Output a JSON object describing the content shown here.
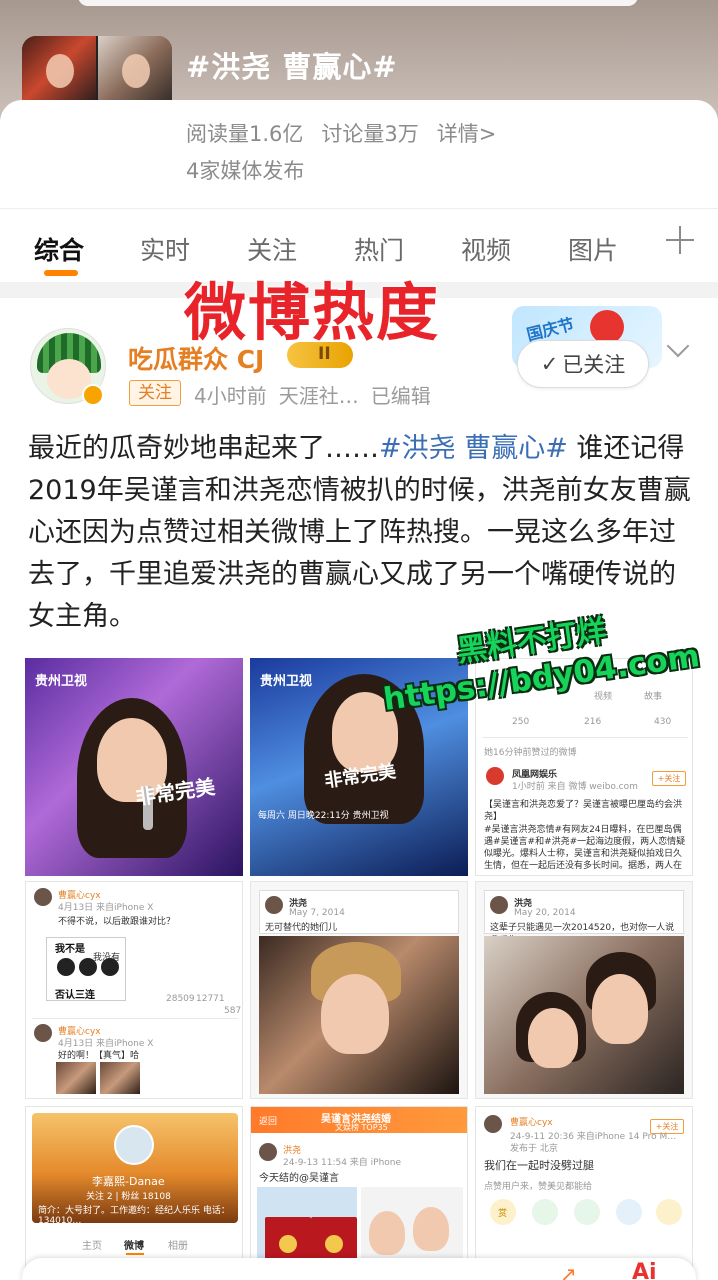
{
  "topic": {
    "title": "#洪尧 曹赢心#",
    "stats": [
      "阅读量1.6亿",
      "讨论量3万",
      "详情>"
    ],
    "media": "4家媒体发布"
  },
  "tabs": [
    "综合",
    "实时",
    "关注",
    "热门",
    "视频",
    "图片"
  ],
  "overlay_title": "微博热度",
  "post": {
    "author": "吃瓜群众 CJ",
    "level_badge": "II",
    "follow_tag": "关注",
    "meta": [
      "4小时前",
      "天涯社…",
      "已编辑"
    ],
    "followed_label": "已关注",
    "sticker_text": "国庆节",
    "text_before": "最近的瓜奇妙地串起来了……",
    "hashtag": "#洪尧 曹赢心#",
    "text_after": " 谁还记得2019年吴谨言和洪尧恋情被扒的时候，洪尧前女友曹赢心还因为点赞过相关微博上了阵热搜。一晃这么多年过去了，千里追爱洪尧的曹赢心又成了另一个嘴硬传说的女主角。"
  },
  "watermark": {
    "line1": "黑料不打烊",
    "line2": "https://bdy04.com"
  },
  "images": {
    "g1": {
      "logo": "贵州卫视",
      "show": "非常完美"
    },
    "g2": {
      "logo": "贵州卫视",
      "show": "非常完美",
      "caption": "每周六 周日晚22:11分 贵州卫视"
    },
    "g3": {
      "tabs": [
        "视频",
        "故事"
      ],
      "counts": [
        "250",
        "216",
        "430"
      ],
      "recent": "她16分钟前赞过的微博",
      "account": "凤凰网娱乐",
      "follow": "+关注",
      "source": "1小时前 来自 微博 weibo.com",
      "headline": "【吴谨言和洪尧恋爱了？吴谨言被曝巴厘岛约会洪尧】",
      "body": "#吴谨言洪尧恋情#有网友24日曝料，在巴厘岛偶遇#吴谨言#和#洪尧#一起海边度假，两人恋情疑似曝光。爆料人士称，吴谨言和洪尧疑似拍戏日久生情，但在一起后还没有多长时间。据悉，两人在《延禧攻略》《蜡笔传》中都有合作。"
    },
    "g4": {
      "user": "曹赢心cyx",
      "time": "4月13日 来自iPhone X",
      "line1": "不得不说，以后敢跟谁对比？",
      "cartoon_top": "我不是",
      "cartoon_mid": "我没有",
      "cartoon_bottom": "否认三连",
      "stats": [
        "28509",
        "12771",
        "587"
      ],
      "user2": "曹赢心cyx",
      "time2": "4月13日 来自iPhone X",
      "line2": "好的啊！【真气】哈"
    },
    "g5": {
      "user": "洪尧",
      "date": "May 7, 2014",
      "text": "无可替代的她们儿"
    },
    "g6": {
      "user": "洪尧",
      "date": "May 20, 2014",
      "text": "这辈子只能遇见一次2014520，也对你一人说我爱你！"
    },
    "g7": {
      "name": "李嘉熙-Danae",
      "follow_count": "关注 2 | 粉丝 18108",
      "bio": "简介：大号封了。工作邀约：经纪人乐乐 电话：134010…",
      "tabs": [
        "主页",
        "微博",
        "相册"
      ]
    },
    "g8": {
      "back": "返回",
      "title": "吴谨言洪尧结婚",
      "subtitle": "文娱榜 TOP35",
      "user": "洪尧",
      "time": "24-9-13 11:54 来自 iPhone",
      "text": "今天结的@吴谨言"
    },
    "g9": {
      "user": "曹赢心cyx",
      "follow": "+关注",
      "time": "24-9-11 20:36 来自iPhone 14 Pro M…",
      "location": "发布于 北京",
      "text": "我们在一起时没劈过腿",
      "footer": "点赞用户来，赞美见都能给",
      "icons": [
        "赏",
        "微信",
        "朋友圈",
        "QQ",
        "收藏"
      ]
    }
  },
  "colors": {
    "accent": "#ff8200",
    "link": "#3b6fb5",
    "username": "#e67e22",
    "overlay_red": "#e8242a",
    "watermark_green": "#16d35a"
  }
}
